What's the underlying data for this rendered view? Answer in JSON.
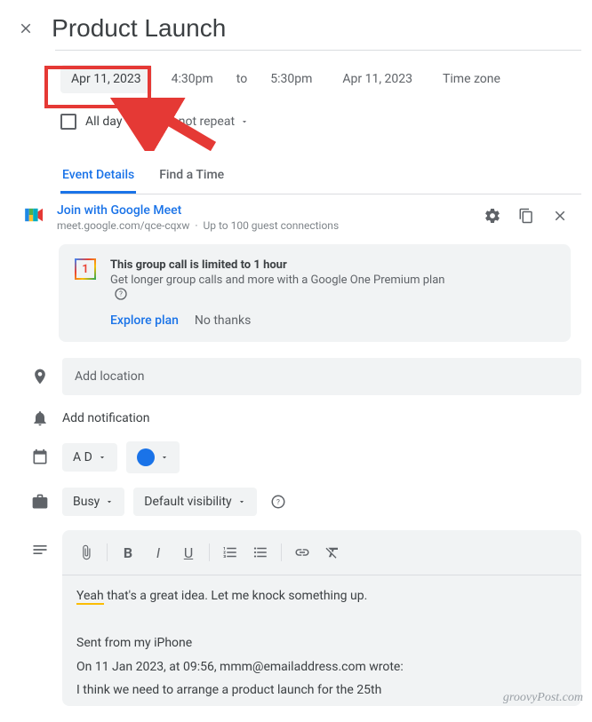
{
  "header": {
    "title": "Product Launch"
  },
  "datetime": {
    "start_date": "Apr 11, 2023",
    "start_time": "4:30pm",
    "to": "to",
    "end_time": "5:30pm",
    "end_date": "Apr 11, 2023",
    "timezone": "Time zone",
    "all_day": "All day",
    "repeat": "Does not repeat"
  },
  "tabs": {
    "details": "Event Details",
    "find_time": "Find a Time"
  },
  "meet": {
    "join": "Join with Google Meet",
    "url": "meet.google.com/qce-cqxw",
    "connections": "Up to 100 guest connections"
  },
  "banner": {
    "title": "This group call is limited to 1 hour",
    "text": "Get longer group calls and more with a Google One Premium plan",
    "explore": "Explore plan",
    "no_thanks": "No thanks"
  },
  "location": {
    "placeholder": "Add location"
  },
  "notification": {
    "add": "Add notification"
  },
  "calendar": {
    "owner": "A D"
  },
  "availability": {
    "busy": "Busy",
    "visibility": "Default visibility"
  },
  "description": {
    "line1a": "Yeah",
    "line1b": " that's a great idea. Let me knock something up.",
    "line2": "Sent from my iPhone",
    "line3": "On 11 Jan 2023, at 09:56, mmm@emailaddress.com wrote:",
    "line4": "I think we need to arrange a product launch for the 25th"
  },
  "watermark": "groovyPost.com"
}
